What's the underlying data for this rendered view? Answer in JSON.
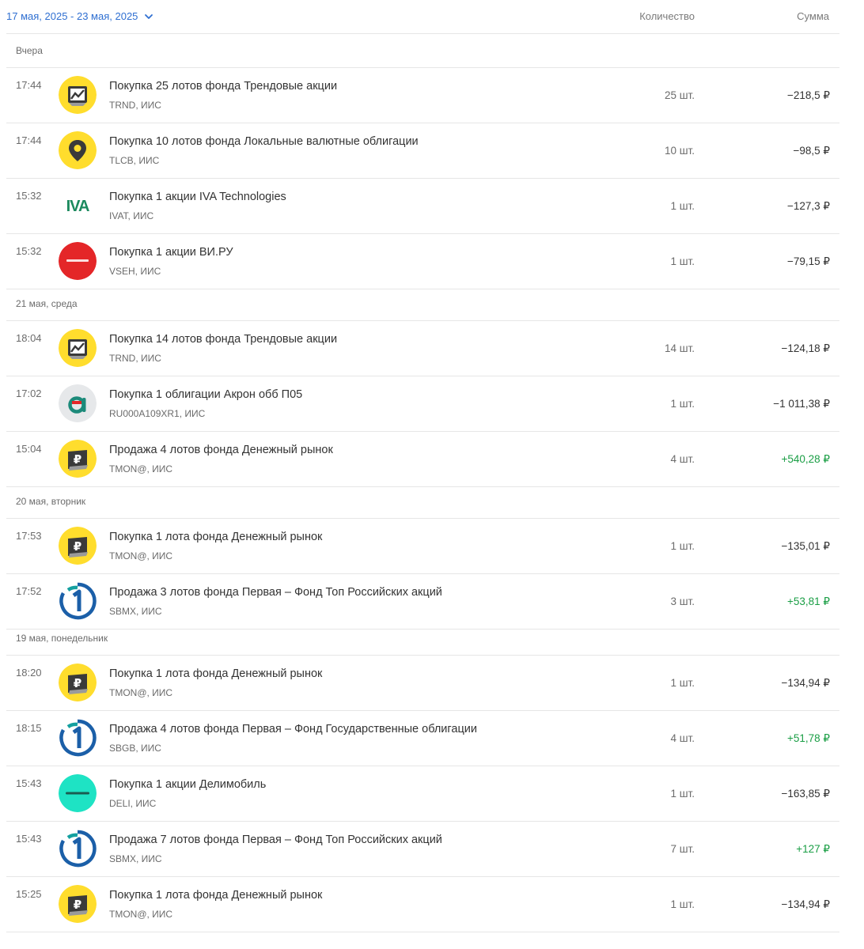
{
  "header": {
    "date_range": "17 мая, 2025 - 23 мая, 2025",
    "col_quantity": "Количество",
    "col_sum": "Сумма"
  },
  "groups": [
    {
      "label": "Вчера",
      "rows": [
        {
          "time": "17:44",
          "logo": "trend-fund-icon",
          "title": "Покупка 25 лотов фонда Трендовые акции",
          "sub": "TRND, ИИС",
          "qty": "25 шт.",
          "amount": "−218,5 ₽",
          "positive": false
        },
        {
          "time": "17:44",
          "logo": "location-pin-icon",
          "title": "Покупка 10 лотов фонда Локальные валютные облигации",
          "sub": "TLCB, ИИС",
          "qty": "10 шт.",
          "amount": "−98,5 ₽",
          "positive": false
        },
        {
          "time": "15:32",
          "logo": "iva-logo",
          "logo_text": "IVA",
          "title": "Покупка 1 акции IVA Technologies",
          "sub": "IVAT, ИИС",
          "qty": "1 шт.",
          "amount": "−127,3 ₽",
          "positive": false
        },
        {
          "time": "15:32",
          "logo": "vseinstrumenti-logo",
          "title": "Покупка 1 акции ВИ.РУ",
          "sub": "VSEH, ИИС",
          "qty": "1 шт.",
          "amount": "−79,15 ₽",
          "positive": false
        }
      ]
    },
    {
      "label": "21 мая, среда",
      "rows": [
        {
          "time": "18:04",
          "logo": "trend-fund-icon",
          "title": "Покупка 14 лотов фонда Трендовые акции",
          "sub": "TRND, ИИС",
          "qty": "14 шт.",
          "amount": "−124,18 ₽",
          "positive": false
        },
        {
          "time": "17:02",
          "logo": "akron-logo",
          "title": "Покупка 1 облигации Акрон обб П05",
          "sub": "RU000A109XR1, ИИС",
          "qty": "1 шт.",
          "amount": "−1 011,38 ₽",
          "positive": false
        },
        {
          "time": "15:04",
          "logo": "ruble-wallet-icon",
          "title": "Продажа 4 лотов фонда Денежный рынок",
          "sub": "TMON@, ИИС",
          "qty": "4 шт.",
          "amount": "+540,28 ₽",
          "positive": true
        }
      ]
    },
    {
      "label": "20 мая, вторник",
      "rows": [
        {
          "time": "17:53",
          "logo": "ruble-wallet-icon",
          "title": "Покупка 1 лота фонда Денежный рынок",
          "sub": "TMON@, ИИС",
          "qty": "1 шт.",
          "amount": "−135,01 ₽",
          "positive": false
        },
        {
          "time": "17:52",
          "logo": "pervaya-logo",
          "title": "Продажа 3 лотов фонда Первая – Фонд Топ Российских акций",
          "sub": "SBMX, ИИС",
          "qty": "3 шт.",
          "amount": "+53,81 ₽",
          "positive": true
        }
      ]
    },
    {
      "label": "19 мая, понедельник",
      "rows": [
        {
          "time": "18:20",
          "logo": "ruble-wallet-icon",
          "title": "Покупка 1 лота фонда Денежный рынок",
          "sub": "TMON@, ИИС",
          "qty": "1 шт.",
          "amount": "−134,94 ₽",
          "positive": false
        },
        {
          "time": "18:15",
          "logo": "pervaya-logo",
          "title": "Продажа 4 лотов фонда Первая – Фонд Государственные облигации",
          "sub": "SBGB, ИИС",
          "qty": "4 шт.",
          "amount": "+51,78 ₽",
          "positive": true
        },
        {
          "time": "15:43",
          "logo": "delimobil-logo",
          "title": "Покупка 1 акции Делимобиль",
          "sub": "DELI, ИИС",
          "qty": "1 шт.",
          "amount": "−163,85 ₽",
          "positive": false
        },
        {
          "time": "15:43",
          "logo": "pervaya-logo",
          "title": "Продажа 7 лотов фонда Первая – Фонд Топ Российских акций",
          "sub": "SBMX, ИИС",
          "qty": "7 шт.",
          "amount": "+127 ₽",
          "positive": true
        },
        {
          "time": "15:25",
          "logo": "ruble-wallet-icon",
          "title": "Покупка 1 лота фонда Денежный рынок",
          "sub": "TMON@, ИИС",
          "qty": "1 шт.",
          "amount": "−134,94 ₽",
          "positive": false
        }
      ]
    }
  ],
  "colors": {
    "link": "#2f6fd1",
    "positive": "#1a9e45",
    "fund_yellow": "#ffdd2d",
    "iva_green": "#1c8a5e",
    "vseh_red": "#e42628",
    "akron_gray": "#e6e8ea",
    "delimobil_teal": "#1ee3c4",
    "pervaya_blue": "#1b5fa8",
    "pervaya_teal": "#14a0a0"
  }
}
